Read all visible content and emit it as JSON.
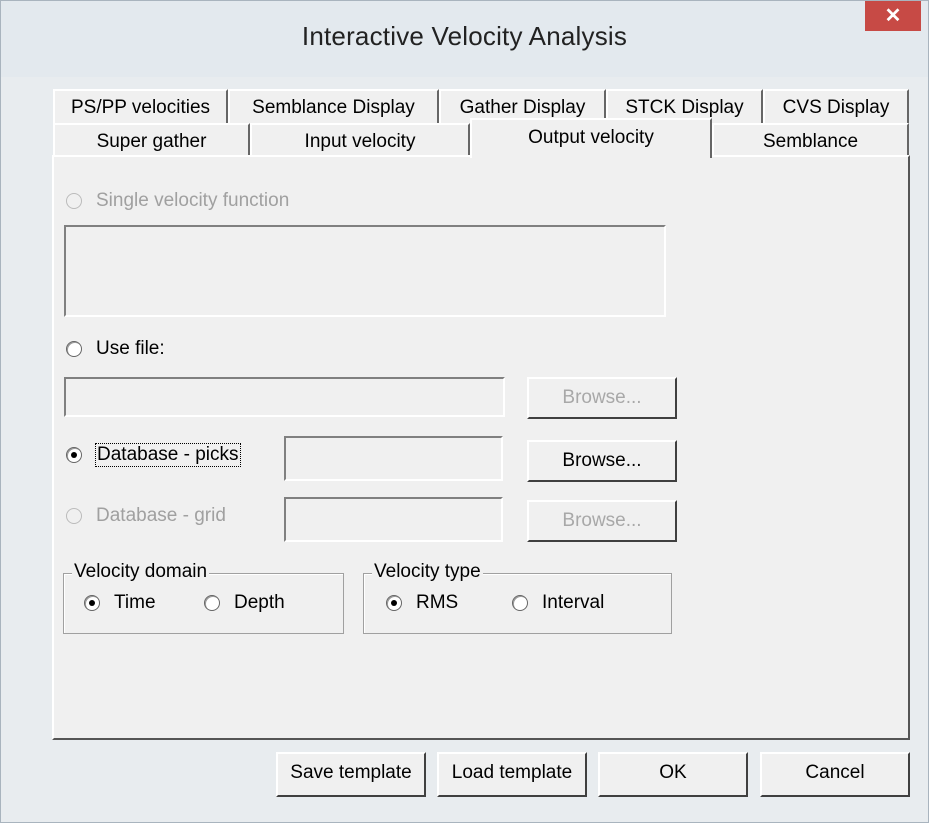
{
  "window": {
    "title": "Interactive Velocity Analysis",
    "close_glyph": "✕"
  },
  "tabs": {
    "row_top": [
      {
        "label": "PS/PP velocities"
      },
      {
        "label": "Semblance Display"
      },
      {
        "label": "Gather Display"
      },
      {
        "label": "STCK Display"
      },
      {
        "label": "CVS Display"
      }
    ],
    "row_bottom": [
      {
        "label": "Super gather"
      },
      {
        "label": "Input velocity"
      },
      {
        "label": "Output velocity",
        "active": true
      },
      {
        "label": "Semblance"
      }
    ]
  },
  "output": {
    "single_function": {
      "label": "Single velocity function",
      "checked": false,
      "enabled": false
    },
    "use_file": {
      "label": "Use file:",
      "checked": false,
      "enabled": true
    },
    "use_file_value": "",
    "use_file_browse": "Browse...",
    "db_picks": {
      "label": "Database - picks",
      "checked": true,
      "enabled": true
    },
    "db_picks_value": "",
    "db_picks_browse": "Browse...",
    "db_grid": {
      "label": "Database - grid",
      "checked": false,
      "enabled": false
    },
    "db_grid_value": "",
    "db_grid_browse": "Browse..."
  },
  "velocity_domain": {
    "legend": "Velocity domain",
    "options": [
      {
        "label": "Time",
        "checked": true
      },
      {
        "label": "Depth",
        "checked": false
      }
    ]
  },
  "velocity_type": {
    "legend": "Velocity type",
    "options": [
      {
        "label": "RMS",
        "checked": true
      },
      {
        "label": "Interval",
        "checked": false
      }
    ]
  },
  "footer": {
    "save_template": "Save template",
    "load_template": "Load template",
    "ok": "OK",
    "cancel": "Cancel"
  },
  "colors": {
    "close_button": "#c74a45",
    "titlebar": "#e3e9ee",
    "dialog_face": "#f0f0f0",
    "disabled_text": "#a0a0a0"
  }
}
